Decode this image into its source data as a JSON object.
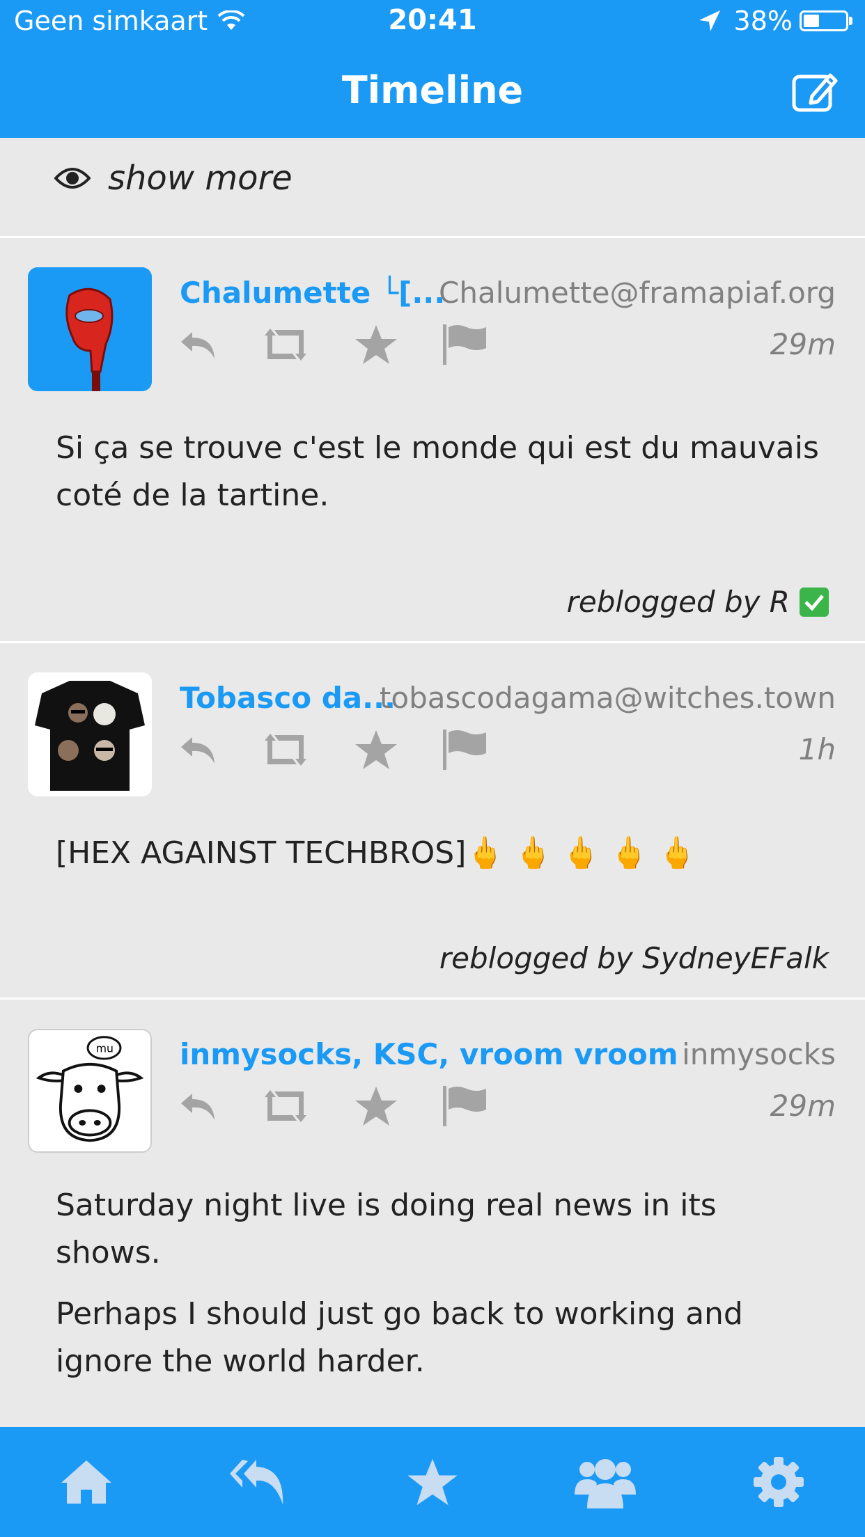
{
  "status_bar": {
    "carrier": "Geen simkaart",
    "time": "20:41",
    "battery": "38%",
    "battery_level": 0.38
  },
  "nav": {
    "title": "Timeline"
  },
  "show_more": {
    "label": "show more"
  },
  "posts": [
    {
      "name": "Chalumette └[...",
      "handle": "Chalumette@framapiaf.org",
      "time": "29m",
      "body": [
        "Si ça se trouve c'est le monde qui est du mauvais coté de la tartine."
      ],
      "reblog": "reblogged by R"
    },
    {
      "name": "Tobasco da...",
      "handle": "tobascodagama@witches.town",
      "time": "1h",
      "body": [
        "[HEX AGAINST TECHBROS]🖕 🖕 🖕 🖕 🖕"
      ],
      "reblog": "reblogged by SydneyEFalk"
    },
    {
      "name": "inmysocks, KSC, vroom vroom",
      "handle": "inmysocks",
      "time": "29m",
      "body": [
        "Saturday night live is doing real news in its shows.",
        "Perhaps I should just go back to working and ignore the world harder."
      ],
      "reblog": ""
    }
  ],
  "tabs": [
    "home-icon",
    "replies-icon",
    "favourites-icon",
    "community-icon",
    "settings-icon"
  ],
  "colors": {
    "accent": "#1b9af5",
    "background": "#e9e9ea",
    "muted": "#808080",
    "icon": "#a4a4a4"
  }
}
